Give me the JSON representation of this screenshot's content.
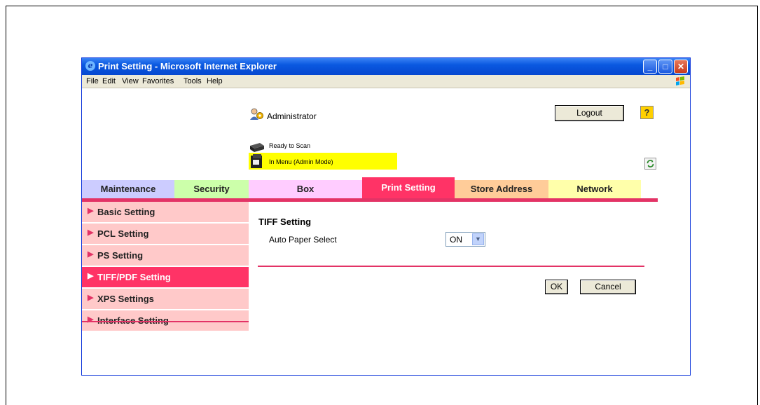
{
  "window": {
    "title": "Print Setting - Microsoft Internet Explorer",
    "buttons": {
      "minimize": "_",
      "maximize": "□",
      "close": "✕"
    }
  },
  "menu": [
    "File",
    "Edit",
    "View",
    "Favorites",
    "Tools",
    "Help"
  ],
  "header": {
    "user": "Administrator",
    "logout_label": "Logout",
    "help_label": "?",
    "status_ready": "Ready to Scan",
    "status_mode": "In Menu (Admin Mode)"
  },
  "tabs": [
    {
      "label": "Maintenance",
      "color": "#ccccff"
    },
    {
      "label": "Security",
      "color": "#ccffaa"
    },
    {
      "label": "Box",
      "color": "#ffccff"
    },
    {
      "label": "Print Setting",
      "color": "#ff3366",
      "active": true
    },
    {
      "label": "Store Address",
      "color": "#ffcc99"
    },
    {
      "label": "Network",
      "color": "#ffffaa"
    }
  ],
  "sidebar": {
    "items": [
      {
        "label": "Basic Setting"
      },
      {
        "label": "PCL Setting"
      },
      {
        "label": "PS Setting"
      },
      {
        "label": "TIFF/PDF Setting",
        "active": true
      },
      {
        "label": "XPS Settings"
      },
      {
        "label": "Interface Setting"
      }
    ]
  },
  "main": {
    "section_title": "TIFF Setting",
    "auto_paper_label": "Auto Paper Select",
    "auto_paper_value": "ON",
    "ok_label": "OK",
    "cancel_label": "Cancel"
  }
}
